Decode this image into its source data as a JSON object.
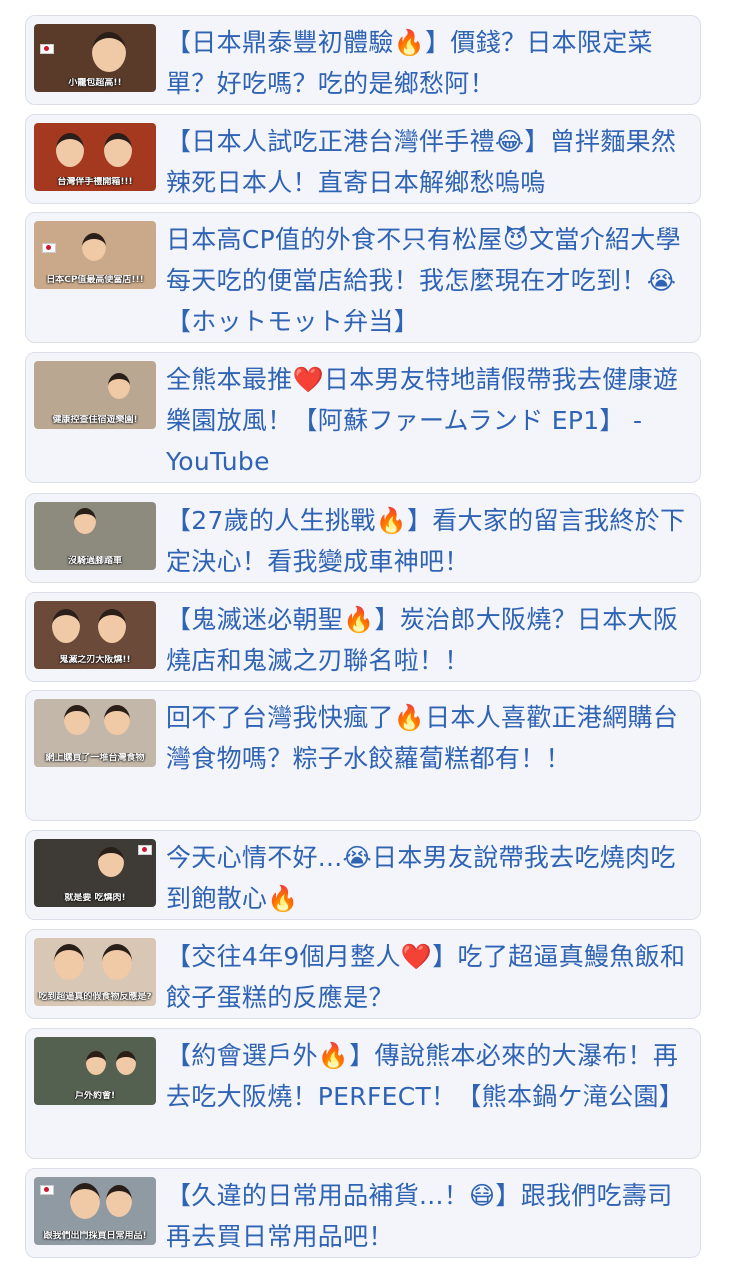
{
  "items": [
    {
      "title": "【日本鼎泰豐初體驗🔥】價錢？日本限定菜單？好吃嗎？吃的是鄉愁阿！",
      "thumb_caption": "小籠包超高!!",
      "thumb_color": "#5a3b2a"
    },
    {
      "title": "【日本人試吃正港台灣伴手禮😂】曾拌麵果然辣死日本人！直寄日本解鄉愁嗚嗚",
      "thumb_caption": "台灣伴手禮開箱!!!",
      "thumb_color": "#a4391f"
    },
    {
      "title": "日本高CP值的外食不只有松屋😈文當介紹大學每天吃的便當店給我！我怎麼現在才吃到！😭【ホットモット弁当】",
      "thumb_caption": "日本CP值最高便當店!!!",
      "thumb_color": "#c9a98a"
    },
    {
      "title": "全熊本最推❤️日本男友特地請假帶我去健康遊樂園放風！【阿蘇ファームランド EP1】 - YouTube",
      "thumb_caption": "健康控查住宿遊樂園!",
      "thumb_color": "#b9a791"
    },
    {
      "title": "【27歲的人生挑戰🔥】看大家的留言我終於下定決心！看我變成車神吧！",
      "thumb_caption": "沒騎過腳踏車",
      "thumb_color": "#8d8a7e"
    },
    {
      "title": "【鬼滅迷必朝聖🔥】炭治郎大阪燒？日本大阪燒店和鬼滅之刃聯名啦！！",
      "thumb_caption": "鬼滅之刃大阪燒!!",
      "thumb_color": "#6b4a3a"
    },
    {
      "title": "回不了台灣我快瘋了🔥日本人喜歡正港網購台灣食物嗎？粽子水餃蘿蔔糕都有！！",
      "thumb_caption": "網上購買了一堆台灣食物",
      "thumb_color": "#c2b7a8"
    },
    {
      "title": "今天心情不好...😭日本男友說帶我去吃燒肉吃到飽散心🔥",
      "thumb_caption": "就是要 吃燒肉!",
      "thumb_color": "#3e3a36"
    },
    {
      "title": "【交往4年9個月整人❤️】吃了超逼真鰻魚飯和餃子蛋糕的反應是？",
      "thumb_caption": "吃到超逼真的假食物反應是?",
      "thumb_color": "#d8c7b4"
    },
    {
      "title": "【約會選戶外🔥】傳說熊本必來的大瀑布！再去吃大阪燒！PERFECT！【熊本鍋ケ滝公園】",
      "thumb_caption": "戶外約會!",
      "thumb_color": "#556150"
    },
    {
      "title": "【久違的日常用品補貨...！😷】跟我們吃壽司再去買日常用品吧！",
      "thumb_caption": "跟我們出門採買日常用品!",
      "thumb_color": "#8f9aa3"
    }
  ]
}
